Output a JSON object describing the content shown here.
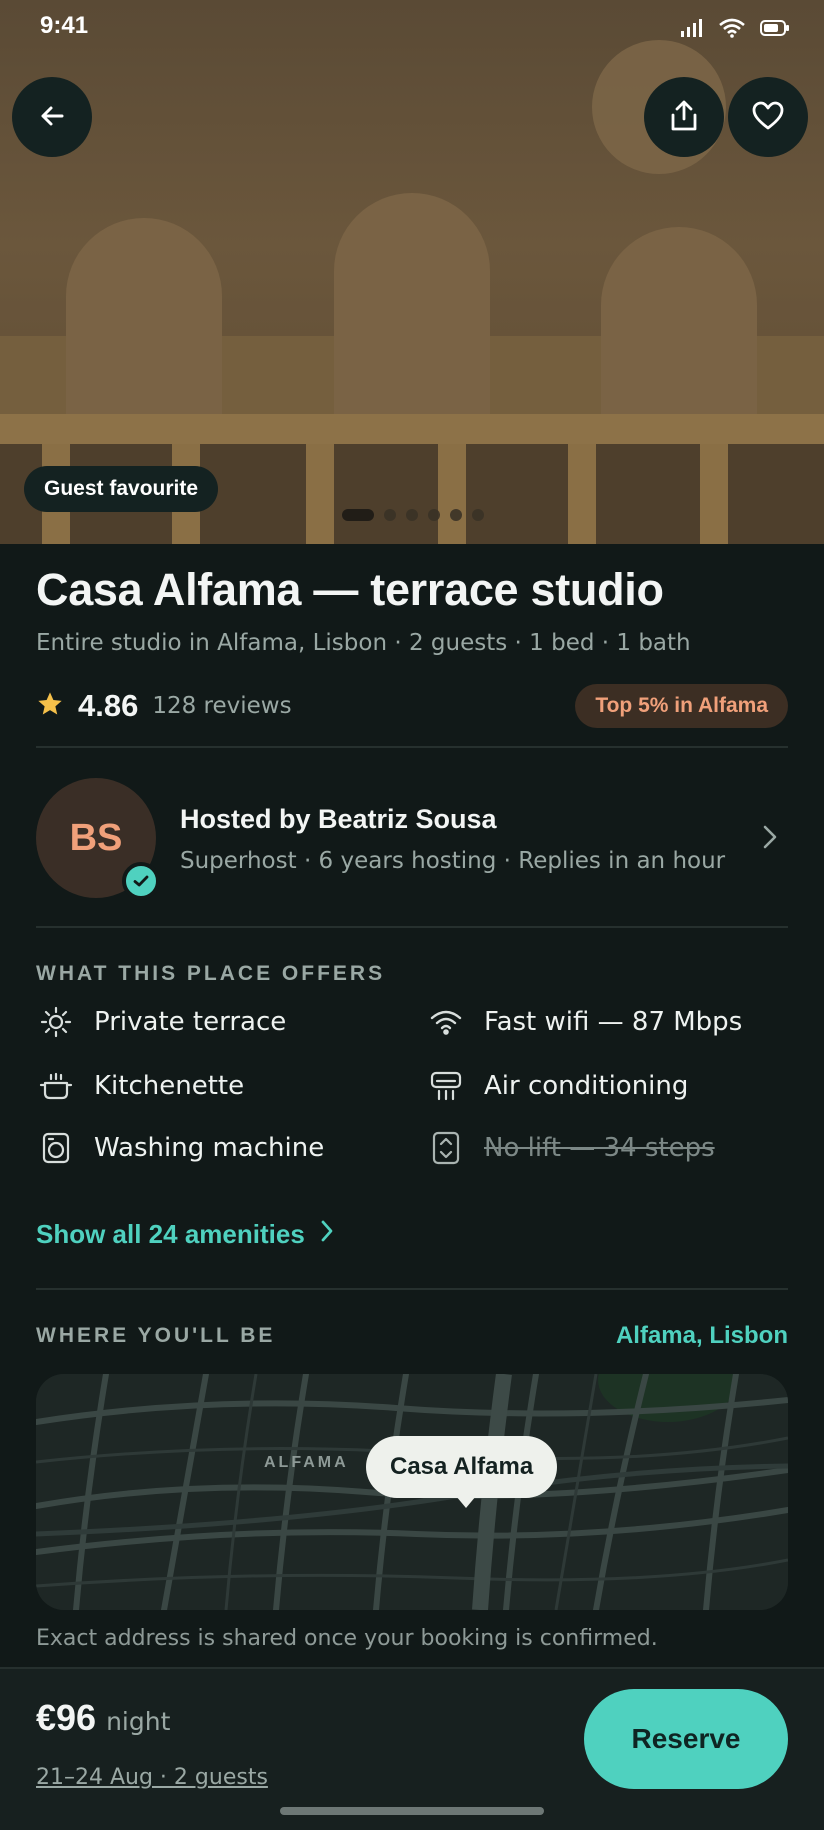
{
  "status_bar": {
    "time": "9:41"
  },
  "hero": {
    "badge": "Guest favourite",
    "photo_count": 6,
    "active_photo": 1,
    "icons": {
      "back": "arrow-left-icon",
      "share": "share-icon",
      "save": "heart-icon"
    }
  },
  "listing": {
    "title": "Casa Alfama — terrace studio",
    "subtitle": "Entire studio in Alfama, Lisbon · 2 guests · 1 bed · 1 bath",
    "rating": "4.86",
    "reviews": "128 reviews",
    "top_badge": "Top 5% in Alfama"
  },
  "host": {
    "initials": "BS",
    "name": "Hosted by Beatriz Sousa",
    "meta": "Superhost · 6 years hosting · Replies in an hour"
  },
  "amenities": {
    "section_title": "WHAT THIS PLACE OFFERS",
    "items": [
      {
        "label": "Private terrace",
        "icon": "sun-icon",
        "available": true
      },
      {
        "label": "Fast wifi — 87 Mbps",
        "icon": "wifi-icon",
        "available": true
      },
      {
        "label": "Kitchenette",
        "icon": "pot-icon",
        "available": true
      },
      {
        "label": "Air conditioning",
        "icon": "ac-icon",
        "available": true
      },
      {
        "label": "Washing machine",
        "icon": "washer-icon",
        "available": true
      },
      {
        "label": "No lift — 34 steps",
        "icon": "lift-icon",
        "available": false
      }
    ],
    "show_all": "Show all 24 amenities"
  },
  "location": {
    "section_title": "WHERE YOU'LL BE",
    "place": "Alfama, Lisbon",
    "map_area_label": "ALFAMA",
    "pin_label": "Casa Alfama",
    "note": "Exact address is shared once your booking is confirmed."
  },
  "booking": {
    "price": "€96",
    "unit": "night",
    "dates": "21–24 Aug · 2 guests",
    "reserve_label": "Reserve"
  },
  "colors": {
    "accent": "#4fd1bf",
    "badge_text": "#f0a07a",
    "background": "#111918"
  }
}
